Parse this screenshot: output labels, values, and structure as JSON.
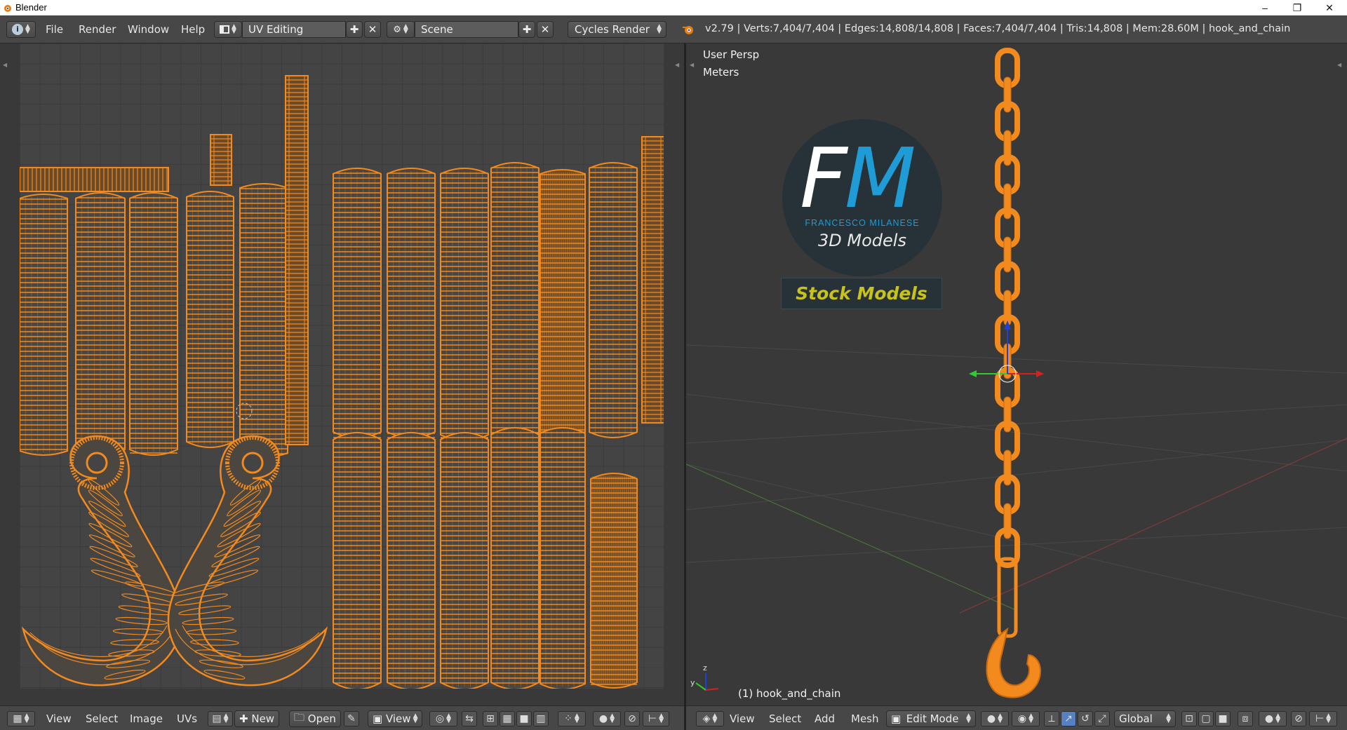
{
  "window": {
    "title": "Blender",
    "minimize": "–",
    "maximize": "❐",
    "close": "✕"
  },
  "topbar": {
    "menus": [
      "File",
      "Render",
      "Window",
      "Help"
    ],
    "layout": "UV Editing",
    "scene": "Scene",
    "engine": "Cycles Render",
    "stats": "v2.79 | Verts:7,404/7,404 | Edges:14,808/14,808 | Faces:7,404/7,404 | Tris:14,808 | Mem:28.60M | hook_and_chain"
  },
  "viewport": {
    "view_name": "User Persp",
    "units": "Meters",
    "object_label": "(1) hook_and_chain",
    "logo": {
      "letters_f": "F",
      "letters_m": "M",
      "subtitle": "FRANCESCO MILANESE",
      "tagline": "3D Models",
      "badge": "Stock Models"
    }
  },
  "uv_header": {
    "menus": [
      "View",
      "Select",
      "Image",
      "UVs"
    ],
    "new_label": "New",
    "open_label": "Open",
    "view_label": "View"
  },
  "view3d_header": {
    "menus": [
      "View",
      "Select",
      "Add",
      "Mesh"
    ],
    "mode": "Edit Mode",
    "orientation": "Global"
  },
  "colors": {
    "accent": "#f28a1e",
    "header": "#474747",
    "background": "#393939",
    "logo_blue": "#1f9bd6",
    "logo_stock": "#c8c21a"
  },
  "icons": [
    "blender-logo-icon",
    "info-editor-icon",
    "screen-layout-icon",
    "scene-icon",
    "add-icon",
    "remove-icon",
    "image-editor-icon",
    "3d-view-icon",
    "axis-gizmo-icon"
  ]
}
